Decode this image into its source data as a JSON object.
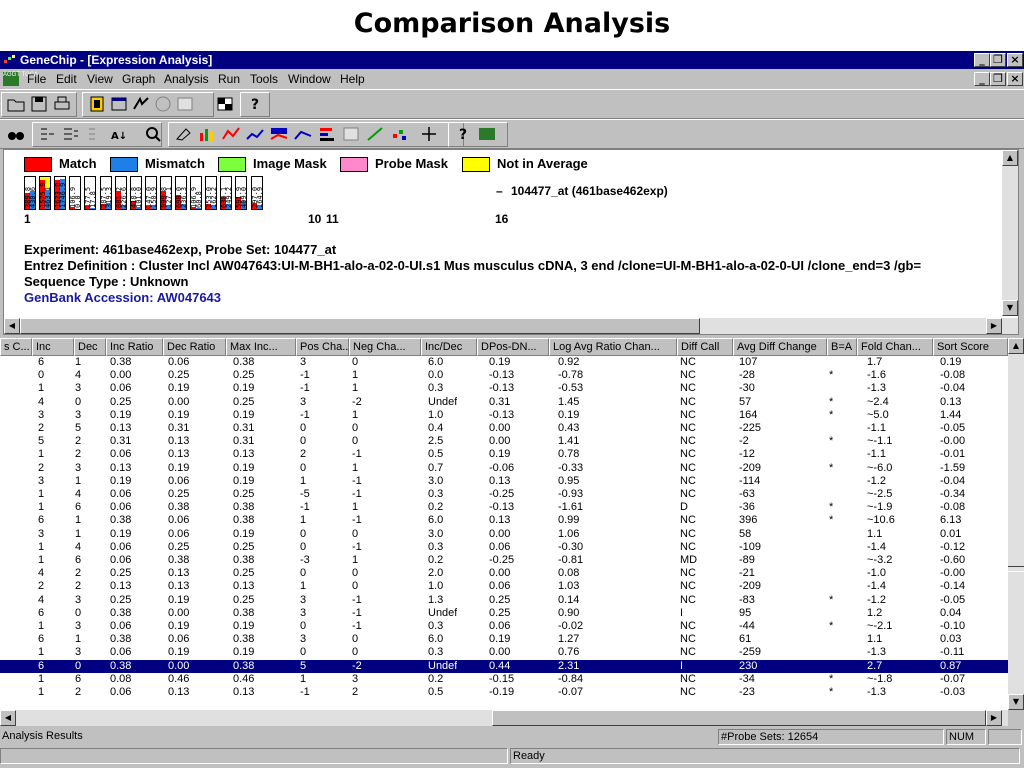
{
  "slide": {
    "title": "Comparison Analysis"
  },
  "window": {
    "title": "GeneChip - [Expression Analysis]",
    "min_glyph": "_",
    "restore_glyph": "❐",
    "close_glyph": "×"
  },
  "menu": {
    "doc_icon_text": "AGGT TGCA",
    "items": [
      "File",
      "Edit",
      "View",
      "Graph",
      "Analysis",
      "Run",
      "Tools",
      "Window",
      "Help"
    ]
  },
  "legend": [
    {
      "label": "Match",
      "color": "#ff0000"
    },
    {
      "label": "Mismatch",
      "color": "#1e7fe6"
    },
    {
      "label": "Image Mask",
      "color": "#7cff3c"
    },
    {
      "label": "Probe Mask",
      "color": "#ff88cc"
    },
    {
      "label": "Not in Average",
      "color": "#ffff00"
    }
  ],
  "probe_pairs": [
    {
      "left": "389.8",
      "right": "430.6",
      "lfill": 0.5,
      "rfill": 0.55,
      "lcolor": "#ff0000",
      "rcolor": "#1e7fe6"
    },
    {
      "left": "1575.9",
      "right": "463.1",
      "lfill": 0.9,
      "rfill": 0.6,
      "lcolor": "#ff0000",
      "rcolor": "#1e7fe6",
      "highlight": "#ffff00"
    },
    {
      "left": "1623.0",
      "right": "1746.9",
      "lfill": 0.9,
      "rfill": 0.95,
      "lcolor": "#ff0000",
      "rcolor": "#1e7fe6"
    },
    {
      "left": "106.9",
      "right": "0.0",
      "lfill": 0.05,
      "rfill": 0.0,
      "lcolor": "#ff0000",
      "rcolor": "#1e7fe6"
    },
    {
      "left": "177.5",
      "right": "17.8",
      "lfill": 0.1,
      "rfill": 0.02,
      "lcolor": "#ff0000",
      "rcolor": "#1e7fe6"
    },
    {
      "left": "287.5",
      "right": "319.3",
      "lfill": 0.15,
      "rfill": 0.18,
      "lcolor": "#ff0000",
      "rcolor": "#1e7fe6"
    },
    {
      "left": "881.2",
      "right": "226.6",
      "lfill": 0.55,
      "rfill": 0.14,
      "lcolor": "#ff0000",
      "rcolor": "#1e7fe6"
    },
    {
      "left": "418.8",
      "right": "101.0",
      "lfill": 0.26,
      "rfill": 0.06,
      "lcolor": "#ff0000",
      "rcolor": "#1e7fe6"
    },
    {
      "left": "147.0",
      "right": "150.9",
      "lfill": 0.09,
      "rfill": 0.09,
      "lcolor": "#ff0000",
      "rcolor": "#1e7fe6"
    },
    {
      "left": "899.8",
      "right": "127.1",
      "lfill": 0.56,
      "rfill": 0.08,
      "lcolor": "#ff0000",
      "rcolor": "#1e7fe6"
    },
    {
      "left": "698.0",
      "right": "236.3",
      "lfill": 0.44,
      "rfill": 0.15,
      "lcolor": "#ff0000",
      "rcolor": "#1e7fe6"
    },
    {
      "left": "106.9",
      "right": "60.8",
      "lfill": 0.07,
      "rfill": 0.04,
      "lcolor": "#ff0000",
      "rcolor": "#1e7fe6"
    },
    {
      "left": "253.0",
      "right": "162.2",
      "lfill": 0.16,
      "rfill": 0.1,
      "lcolor": "#ff0000",
      "rcolor": "#1e7fe6"
    },
    {
      "left": "630.1",
      "right": "249.2",
      "lfill": 0.39,
      "rfill": 0.16,
      "lcolor": "#ff0000",
      "rcolor": "#1e7fe6"
    },
    {
      "left": "591.9",
      "right": "409.0",
      "lfill": 0.37,
      "rfill": 0.26,
      "lcolor": "#ff0000",
      "rcolor": "#1e7fe6"
    },
    {
      "left": "297.0",
      "right": "164.9",
      "lfill": 0.19,
      "rfill": 0.1,
      "lcolor": "#ff0000",
      "rcolor": "#1e7fe6"
    }
  ],
  "probe_numbers": [
    "1",
    "10",
    "11",
    "16"
  ],
  "probe_label": "104477_at (461base462exp)",
  "probe_dash": "–",
  "info": {
    "experiment": "Experiment: 461base462exp, Probe Set: 104477_at",
    "entrez": "Entrez Definition : Cluster Incl AW047643:UI-M-BH1-alo-a-02-0-UI.s1 Mus musculus cDNA, 3  end /clone=UI-M-BH1-alo-a-02-0-UI /clone_end=3  /gb=",
    "sequence": "Sequence Type : Unknown",
    "genbank": "GenBank Accession: AW047643"
  },
  "scroll": {
    "up": "▲",
    "down": "▼",
    "left": "◀",
    "right": "▶"
  },
  "table": {
    "columns": [
      "s C...",
      "Inc",
      "Dec",
      "Inc Ratio",
      "Dec Ratio",
      "Max Inc...",
      "Pos Cha...",
      "Neg Cha...",
      "Inc/Dec",
      "DPos-DN...",
      "Log Avg Ratio Chan...",
      "Diff Call",
      "Avg Diff Change",
      "B=A",
      "Fold Chan...",
      "Sort Score"
    ],
    "rows": [
      [
        "",
        "6",
        "1",
        "0.38",
        "0.06",
        "0.38",
        "3",
        "0",
        "6.0",
        "0.19",
        "0.92",
        "NC",
        "107",
        "",
        "1.7",
        "0.19"
      ],
      [
        "",
        "0",
        "4",
        "0.00",
        "0.25",
        "0.25",
        "-1",
        "1",
        "0.0",
        "-0.13",
        "-0.78",
        "NC",
        "-28",
        "*",
        "-1.6",
        "-0.08"
      ],
      [
        "",
        "1",
        "3",
        "0.06",
        "0.19",
        "0.19",
        "-1",
        "1",
        "0.3",
        "-0.13",
        "-0.53",
        "NC",
        "-30",
        "",
        "-1.3",
        "-0.04"
      ],
      [
        "",
        "4",
        "0",
        "0.25",
        "0.00",
        "0.25",
        "3",
        "-2",
        "Undef",
        "0.31",
        "1.45",
        "NC",
        "57",
        "*",
        "~2.4",
        "0.13"
      ],
      [
        "",
        "3",
        "3",
        "0.19",
        "0.19",
        "0.19",
        "-1",
        "1",
        "1.0",
        "-0.13",
        "0.19",
        "NC",
        "164",
        "*",
        "~5.0",
        "1.44"
      ],
      [
        "",
        "2",
        "5",
        "0.13",
        "0.31",
        "0.31",
        "0",
        "0",
        "0.4",
        "0.00",
        "0.43",
        "NC",
        "-225",
        "",
        "-1.1",
        "-0.05"
      ],
      [
        "",
        "5",
        "2",
        "0.31",
        "0.13",
        "0.31",
        "0",
        "0",
        "2.5",
        "0.00",
        "1.41",
        "NC",
        "-2",
        "*",
        "~-1.1",
        "-0.00"
      ],
      [
        "",
        "1",
        "2",
        "0.06",
        "0.13",
        "0.13",
        "2",
        "-1",
        "0.5",
        "0.19",
        "0.78",
        "NC",
        "-12",
        "",
        "-1.1",
        "-0.01"
      ],
      [
        "",
        "2",
        "3",
        "0.13",
        "0.19",
        "0.19",
        "0",
        "1",
        "0.7",
        "-0.06",
        "-0.33",
        "NC",
        "-209",
        "*",
        "~-6.0",
        "-1.59"
      ],
      [
        "",
        "3",
        "1",
        "0.19",
        "0.06",
        "0.19",
        "1",
        "-1",
        "3.0",
        "0.13",
        "0.95",
        "NC",
        "-114",
        "",
        "-1.2",
        "-0.04"
      ],
      [
        "",
        "1",
        "4",
        "0.06",
        "0.25",
        "0.25",
        "-5",
        "-1",
        "0.3",
        "-0.25",
        "-0.93",
        "NC",
        "-63",
        "",
        "~-2.5",
        "-0.34"
      ],
      [
        "",
        "1",
        "6",
        "0.06",
        "0.38",
        "0.38",
        "-1",
        "1",
        "0.2",
        "-0.13",
        "-1.61",
        "D",
        "-36",
        "*",
        "~-1.9",
        "-0.08"
      ],
      [
        "",
        "6",
        "1",
        "0.38",
        "0.06",
        "0.38",
        "1",
        "-1",
        "6.0",
        "0.13",
        "0.99",
        "NC",
        "396",
        "*",
        "~10.6",
        "6.13"
      ],
      [
        "",
        "3",
        "1",
        "0.19",
        "0.06",
        "0.19",
        "0",
        "0",
        "3.0",
        "0.00",
        "1.06",
        "NC",
        "58",
        "",
        "1.1",
        "0.01"
      ],
      [
        "",
        "1",
        "4",
        "0.06",
        "0.25",
        "0.25",
        "0",
        "-1",
        "0.3",
        "0.06",
        "-0.30",
        "NC",
        "-109",
        "",
        "-1.4",
        "-0.12"
      ],
      [
        "",
        "1",
        "6",
        "0.06",
        "0.38",
        "0.38",
        "-3",
        "1",
        "0.2",
        "-0.25",
        "-0.81",
        "MD",
        "-89",
        "",
        "~-3.2",
        "-0.60"
      ],
      [
        "",
        "4",
        "2",
        "0.25",
        "0.13",
        "0.25",
        "0",
        "0",
        "2.0",
        "0.00",
        "0.08",
        "NC",
        "-21",
        "",
        "-1.0",
        "-0.00"
      ],
      [
        "",
        "2",
        "2",
        "0.13",
        "0.13",
        "0.13",
        "1",
        "0",
        "1.0",
        "0.06",
        "1.03",
        "NC",
        "-209",
        "",
        "-1.4",
        "-0.14"
      ],
      [
        "",
        "4",
        "3",
        "0.25",
        "0.19",
        "0.25",
        "3",
        "-1",
        "1.3",
        "0.25",
        "0.14",
        "NC",
        "-83",
        "*",
        "-1.2",
        "-0.05"
      ],
      [
        "",
        "6",
        "0",
        "0.38",
        "0.00",
        "0.38",
        "3",
        "-1",
        "Undef",
        "0.25",
        "0.90",
        "I",
        "95",
        "",
        "1.2",
        "0.04"
      ],
      [
        "",
        "1",
        "3",
        "0.06",
        "0.19",
        "0.19",
        "0",
        "-1",
        "0.3",
        "0.06",
        "-0.02",
        "NC",
        "-44",
        "*",
        "~-2.1",
        "-0.10"
      ],
      [
        "",
        "6",
        "1",
        "0.38",
        "0.06",
        "0.38",
        "3",
        "0",
        "6.0",
        "0.19",
        "1.27",
        "NC",
        "61",
        "",
        "1.1",
        "0.03"
      ],
      [
        "",
        "1",
        "3",
        "0.06",
        "0.19",
        "0.19",
        "0",
        "0",
        "0.3",
        "0.00",
        "0.76",
        "NC",
        "-259",
        "",
        "-1.3",
        "-0.11"
      ],
      [
        "",
        "6",
        "0",
        "0.38",
        "0.00",
        "0.38",
        "5",
        "-2",
        "Undef",
        "0.44",
        "2.31",
        "I",
        "230",
        "",
        "2.7",
        "0.87"
      ],
      [
        "",
        "1",
        "6",
        "0.08",
        "0.46",
        "0.46",
        "1",
        "3",
        "0.2",
        "-0.15",
        "-0.84",
        "NC",
        "-34",
        "*",
        "~-1.8",
        "-0.07"
      ],
      [
        "",
        "1",
        "2",
        "0.06",
        "0.13",
        "0.13",
        "-1",
        "2",
        "0.5",
        "-0.19",
        "-0.07",
        "NC",
        "-23",
        "*",
        "-1.3",
        "-0.03"
      ]
    ],
    "selected_row": 23
  },
  "status": {
    "left": "Analysis Results",
    "probe_sets": "#Probe Sets: 12654",
    "num": "NUM",
    "ready": "Ready"
  }
}
